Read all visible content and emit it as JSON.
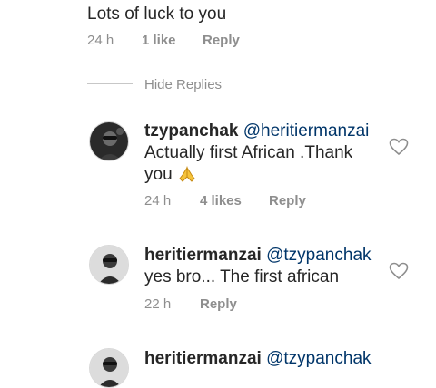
{
  "parent_comment": {
    "text": "Lots of luck to you",
    "time": "24 h",
    "likes": "1 like",
    "reply_label": "Reply"
  },
  "hide_replies_label": "Hide Replies",
  "replies": [
    {
      "username": "tzypanchak",
      "mention": "@heritiermanzai",
      "text_line1": "Actually first African .Thank",
      "text_line2": "you",
      "emoji": "praying-hands",
      "time": "24 h",
      "likes": "4 likes",
      "reply_label": "Reply"
    },
    {
      "username": "heritiermanzai",
      "mention": "@tzypanchak",
      "text_line1": "yes bro... The first african",
      "time": "22 h",
      "reply_label": "Reply"
    },
    {
      "username": "heritiermanzai",
      "mention": "@tzypanchak"
    }
  ],
  "colors": {
    "text": "#262626",
    "meta": "#8e8e8e",
    "mention": "#003569",
    "divider": "#c7c7c7"
  }
}
